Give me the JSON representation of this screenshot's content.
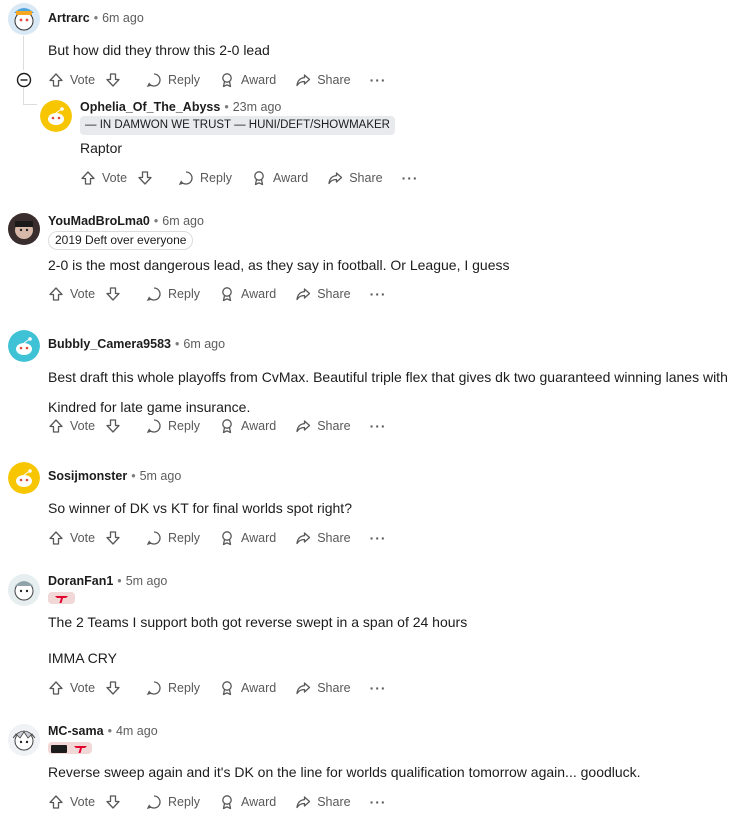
{
  "actions": {
    "vote": "Vote",
    "reply": "Reply",
    "award": "Award",
    "share": "Share",
    "more": "···"
  },
  "comments": [
    {
      "user": "Artrarc",
      "dot": "•",
      "time": "6m ago",
      "text": [
        "But how did they throw this 2-0 lead"
      ]
    },
    {
      "user": "Ophelia_Of_The_Abyss",
      "dot": "•",
      "time": "23m ago",
      "flair": "— IN DAMWON WE TRUST — HUNI/DEFT/SHOWMAKER",
      "text": [
        "Raptor"
      ]
    },
    {
      "user": "YouMadBroLma0",
      "dot": "•",
      "time": "6m ago",
      "flair": "2019 Deft over everyone",
      "text": [
        "2-0 is the most dangerous lead, as they say in football. Or League, I guess"
      ]
    },
    {
      "user": "Bubbly_Camera9583",
      "dot": "•",
      "time": "6m ago",
      "text": [
        "Best draft this whole playoffs from CvMax. Beautiful triple flex that gives dk two guaranteed winning lanes with",
        "Kindred for late game insurance."
      ]
    },
    {
      "user": "Sosijmonster",
      "dot": "•",
      "time": "5m ago",
      "text": [
        "So winner of DK vs KT for final worlds spot right?"
      ]
    },
    {
      "user": "DoranFan1",
      "dot": "•",
      "time": "5m ago",
      "text": [
        "The 2 Teams I support both got reverse swept in a span of 24 hours",
        "IMMA CRY"
      ]
    },
    {
      "user": "MC-sama",
      "dot": "•",
      "time": "4m ago",
      "text": [
        "Reverse sweep again and it's DK on the line for worlds qualification tomorrow again... goodluck."
      ]
    }
  ],
  "colors": {
    "accent": "#0079d3",
    "muted": "#585858",
    "snoo_yellow": "#f7c600",
    "teal": "#3fc1d6"
  }
}
